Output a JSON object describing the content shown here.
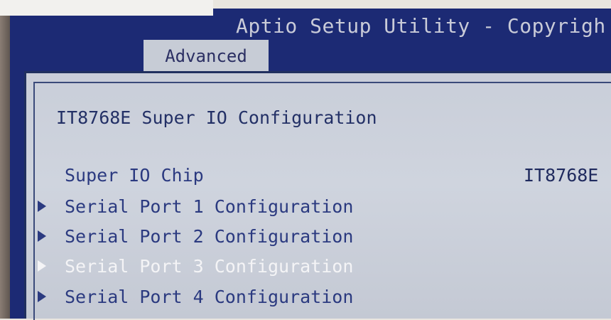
{
  "header": {
    "title": "Aptio Setup Utility - Copyrigh"
  },
  "tabs": [
    {
      "label": "Advanced",
      "active": true
    }
  ],
  "page": {
    "section_title": "IT8768E Super IO Configuration",
    "items": [
      {
        "label": "Super IO Chip",
        "value": "IT8768E",
        "submenu": false,
        "selected": false
      },
      {
        "label": "Serial Port 1 Configuration",
        "submenu": true,
        "selected": false
      },
      {
        "label": "Serial Port 2 Configuration",
        "submenu": true,
        "selected": false
      },
      {
        "label": "Serial Port 3 Configuration",
        "submenu": true,
        "selected": true
      },
      {
        "label": "Serial Port 4 Configuration",
        "submenu": true,
        "selected": false
      }
    ]
  },
  "colors": {
    "header_bg": "#1c2a74",
    "content_bg": "#cfd4de",
    "item_text": "#2b3a80",
    "selected_text": "#f4f4f6"
  },
  "icons": {
    "submenu": "right-triangle-icon"
  }
}
